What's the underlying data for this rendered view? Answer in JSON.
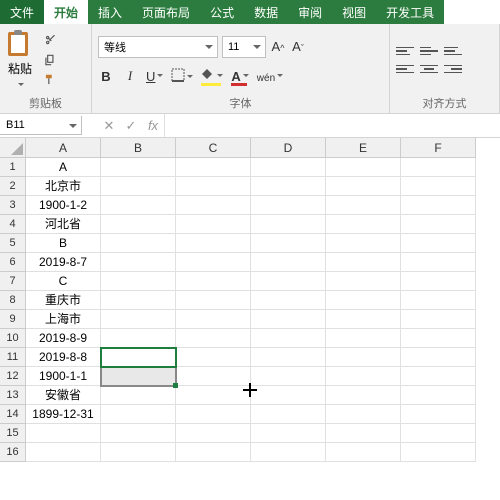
{
  "tabs": [
    "文件",
    "开始",
    "插入",
    "页面布局",
    "公式",
    "数据",
    "审阅",
    "视图",
    "开发工具"
  ],
  "activeTab": 1,
  "ribbon": {
    "clipboard": {
      "paste": "粘贴",
      "label": "剪贴板"
    },
    "font": {
      "name": "等线",
      "size": "11",
      "label": "字体",
      "wen": "wén"
    },
    "align": {
      "label": "对齐方式"
    }
  },
  "namebox": "B11",
  "fx": "fx",
  "columns": [
    "A",
    "B",
    "C",
    "D",
    "E",
    "F"
  ],
  "rows": [
    {
      "r": "1",
      "A": "A"
    },
    {
      "r": "2",
      "A": "北京市"
    },
    {
      "r": "3",
      "A": "1900-1-2"
    },
    {
      "r": "4",
      "A": "河北省"
    },
    {
      "r": "5",
      "A": "B"
    },
    {
      "r": "6",
      "A": "2019-8-7"
    },
    {
      "r": "7",
      "A": "C"
    },
    {
      "r": "8",
      "A": "重庆市"
    },
    {
      "r": "9",
      "A": "上海市"
    },
    {
      "r": "10",
      "A": "2019-8-9"
    },
    {
      "r": "11",
      "A": "2019-8-8"
    },
    {
      "r": "12",
      "A": "1900-1-1"
    },
    {
      "r": "13",
      "A": "安徽省"
    },
    {
      "r": "14",
      "A": "1899-12-31"
    },
    {
      "r": "15",
      "A": ""
    },
    {
      "r": "16",
      "A": ""
    }
  ],
  "selectedCell": "B11",
  "grayCell": "B12"
}
